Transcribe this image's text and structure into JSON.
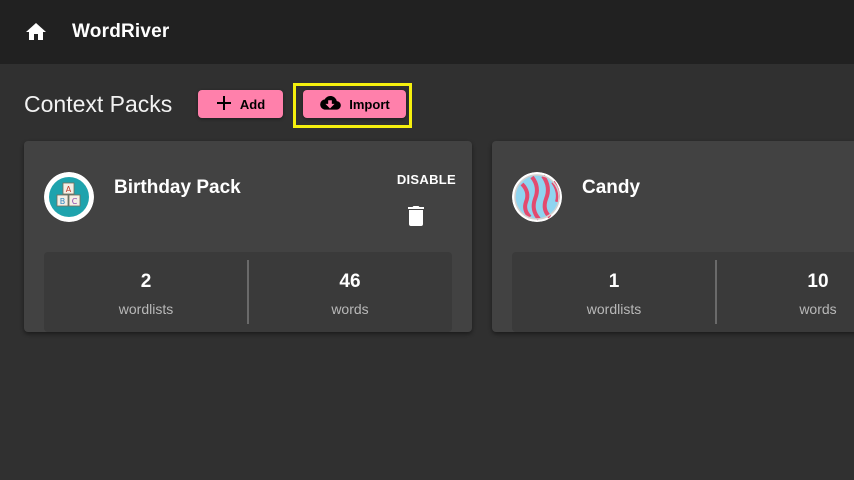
{
  "app": {
    "title": "WordRiver",
    "home_icon": "home-icon"
  },
  "page": {
    "title": "Context Packs",
    "add_label": "Add",
    "import_label": "Import",
    "accent": "#ff80ab",
    "highlight": "#f5f00e"
  },
  "packs": [
    {
      "name": "Birthday Pack",
      "icon": "abc-blocks-icon",
      "action_label": "DISABLE",
      "wordlists_count": "2",
      "wordlists_label": "wordlists",
      "words_count": "46",
      "words_label": "words"
    },
    {
      "name": "Candy",
      "icon": "candy-swirl-icon",
      "wordlists_count": "1",
      "wordlists_label": "wordlists",
      "words_count": "10",
      "words_label": "words"
    }
  ]
}
